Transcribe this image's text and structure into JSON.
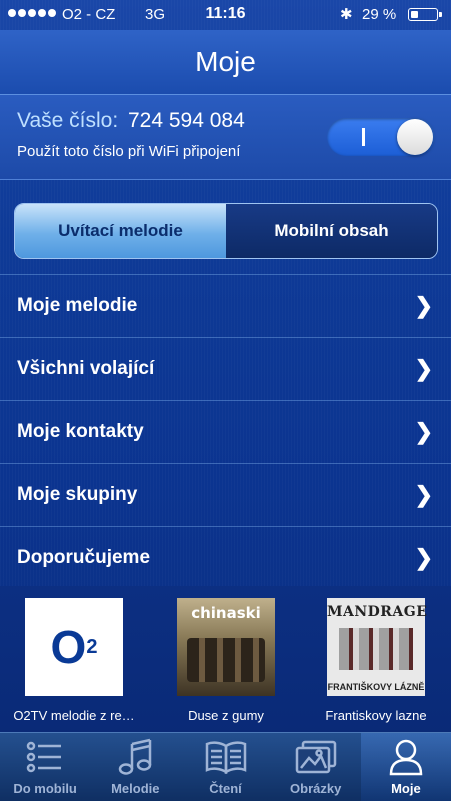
{
  "status": {
    "carrier": "O2 - CZ",
    "network": "3G",
    "time": "11:16",
    "battery": "29 %"
  },
  "header": {
    "title": "Moje"
  },
  "number": {
    "label": "Vaše číslo:",
    "value": "724 594 084",
    "wifi_text": "Použít toto číslo při WiFi připojení",
    "toggle_on": true
  },
  "segments": [
    {
      "label": "Uvítací melodie"
    },
    {
      "label": "Mobilní obsah"
    }
  ],
  "menu": [
    {
      "label": "Moje melodie"
    },
    {
      "label": "Všichni volající"
    },
    {
      "label": "Moje kontakty"
    },
    {
      "label": "Moje skupiny"
    },
    {
      "label": "Doporučujeme"
    }
  ],
  "featured": [
    {
      "caption": "O2TV melodie z re…",
      "art_text": "O",
      "art_sub": "2"
    },
    {
      "caption": "Duse z gumy",
      "art_text": "chinaski"
    },
    {
      "caption": "Frantiskovy lazne",
      "art_text": "MANDRAGE",
      "art_sub": "FRANTIŠKOVY LÁZNĚ"
    }
  ],
  "tabs": [
    {
      "label": "Do mobilu",
      "icon": "list-icon"
    },
    {
      "label": "Melodie",
      "icon": "music-note-icon"
    },
    {
      "label": "Čtení",
      "icon": "book-icon"
    },
    {
      "label": "Obrázky",
      "icon": "pictures-icon"
    },
    {
      "label": "Moje",
      "icon": "person-icon"
    }
  ],
  "colors": {
    "accent": "#1c5ed6",
    "background": "#0b2d7e",
    "segment_active": "#6fb0e9"
  }
}
